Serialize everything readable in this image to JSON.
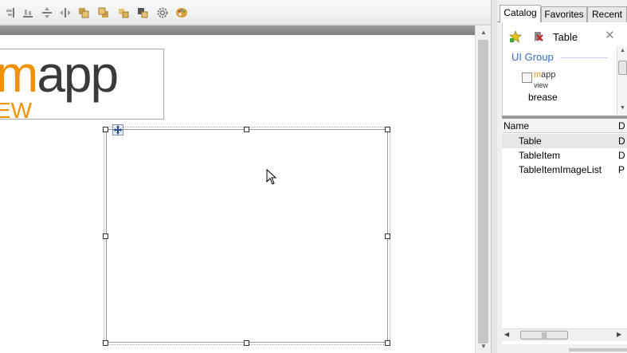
{
  "toolbar": {
    "buttons": [
      {
        "icon": "align-right-icon"
      },
      {
        "icon": "align-bottom-icon"
      },
      {
        "icon": "center-vertical-icon"
      },
      {
        "icon": "center-horizontal-icon"
      },
      {
        "icon": "bring-forward-icon"
      },
      {
        "icon": "send-backward-icon"
      },
      {
        "icon": "bring-to-front-icon"
      },
      {
        "icon": "send-to-back-icon"
      },
      {
        "icon": "gear-icon"
      },
      {
        "icon": "palette-icon"
      }
    ]
  },
  "canvas": {
    "logo": {
      "main_accent": "m",
      "main_rest": "app",
      "sub": "EW"
    },
    "selected_component": "Table"
  },
  "catalog_panel": {
    "tabs": [
      {
        "label": "Catalog",
        "active": true
      },
      {
        "label": "Favorites",
        "active": false
      },
      {
        "label": "Recent",
        "active": false
      }
    ],
    "search": {
      "value": "Table"
    },
    "group": {
      "title": "UI Group",
      "item": {
        "logo_accent": "m",
        "logo_rest": "app",
        "logo_sub": "view",
        "label": "brease"
      }
    },
    "list": {
      "columns": [
        "Name",
        "D"
      ],
      "rows": [
        {
          "name": "Table",
          "desc": "D",
          "selected": true
        },
        {
          "name": "TableItem",
          "desc": "D",
          "selected": false
        },
        {
          "name": "TableItemImageList",
          "desc": "P",
          "selected": false
        }
      ]
    }
  },
  "colors": {
    "brand_orange": "#f29100",
    "group_title_blue": "#3a6fc4",
    "logo_gray": "#3a3a3a"
  }
}
